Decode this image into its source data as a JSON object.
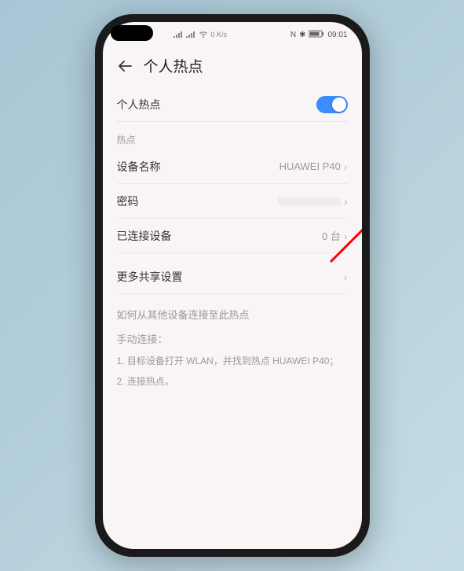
{
  "status_bar": {
    "net_speed": "0 K/s",
    "nfc": "N",
    "bt": "✱",
    "battery": "▮▮▯",
    "time": "09:01"
  },
  "header": {
    "title": "个人热点"
  },
  "hotspot": {
    "toggle_label": "个人热点",
    "enabled": true
  },
  "section_hotspot": "热点",
  "device_name": {
    "label": "设备名称",
    "value": "HUAWEI P40"
  },
  "password": {
    "label": "密码"
  },
  "connected": {
    "label": "已连接设备",
    "value": "0 台"
  },
  "more_sharing": {
    "label": "更多共享设置"
  },
  "help": {
    "title": "如何从其他设备连接至此热点",
    "manual_label": "手动连接：",
    "step1": "1. 目标设备打开 WLAN，并找到热点 HUAWEI P40；",
    "step2": "2. 连接热点。"
  }
}
